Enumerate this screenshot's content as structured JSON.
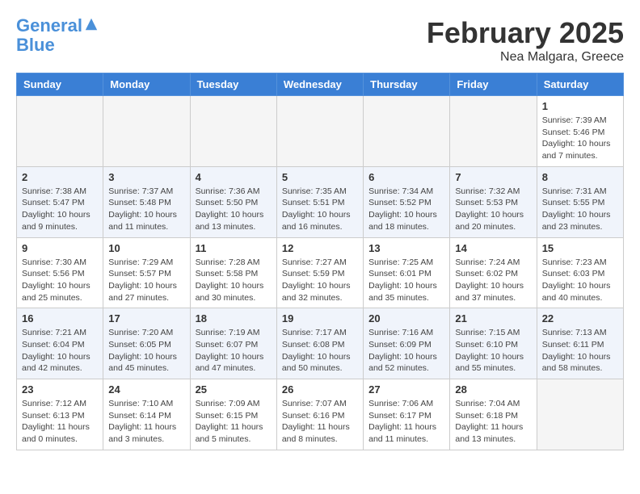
{
  "logo": {
    "line1": "General",
    "line2": "Blue"
  },
  "title": "February 2025",
  "location": "Nea Malgara, Greece",
  "weekdays": [
    "Sunday",
    "Monday",
    "Tuesday",
    "Wednesday",
    "Thursday",
    "Friday",
    "Saturday"
  ],
  "weeks": [
    [
      {
        "day": "",
        "info": ""
      },
      {
        "day": "",
        "info": ""
      },
      {
        "day": "",
        "info": ""
      },
      {
        "day": "",
        "info": ""
      },
      {
        "day": "",
        "info": ""
      },
      {
        "day": "",
        "info": ""
      },
      {
        "day": "1",
        "info": "Sunrise: 7:39 AM\nSunset: 5:46 PM\nDaylight: 10 hours and 7 minutes."
      }
    ],
    [
      {
        "day": "2",
        "info": "Sunrise: 7:38 AM\nSunset: 5:47 PM\nDaylight: 10 hours and 9 minutes."
      },
      {
        "day": "3",
        "info": "Sunrise: 7:37 AM\nSunset: 5:48 PM\nDaylight: 10 hours and 11 minutes."
      },
      {
        "day": "4",
        "info": "Sunrise: 7:36 AM\nSunset: 5:50 PM\nDaylight: 10 hours and 13 minutes."
      },
      {
        "day": "5",
        "info": "Sunrise: 7:35 AM\nSunset: 5:51 PM\nDaylight: 10 hours and 16 minutes."
      },
      {
        "day": "6",
        "info": "Sunrise: 7:34 AM\nSunset: 5:52 PM\nDaylight: 10 hours and 18 minutes."
      },
      {
        "day": "7",
        "info": "Sunrise: 7:32 AM\nSunset: 5:53 PM\nDaylight: 10 hours and 20 minutes."
      },
      {
        "day": "8",
        "info": "Sunrise: 7:31 AM\nSunset: 5:55 PM\nDaylight: 10 hours and 23 minutes."
      }
    ],
    [
      {
        "day": "9",
        "info": "Sunrise: 7:30 AM\nSunset: 5:56 PM\nDaylight: 10 hours and 25 minutes."
      },
      {
        "day": "10",
        "info": "Sunrise: 7:29 AM\nSunset: 5:57 PM\nDaylight: 10 hours and 27 minutes."
      },
      {
        "day": "11",
        "info": "Sunrise: 7:28 AM\nSunset: 5:58 PM\nDaylight: 10 hours and 30 minutes."
      },
      {
        "day": "12",
        "info": "Sunrise: 7:27 AM\nSunset: 5:59 PM\nDaylight: 10 hours and 32 minutes."
      },
      {
        "day": "13",
        "info": "Sunrise: 7:25 AM\nSunset: 6:01 PM\nDaylight: 10 hours and 35 minutes."
      },
      {
        "day": "14",
        "info": "Sunrise: 7:24 AM\nSunset: 6:02 PM\nDaylight: 10 hours and 37 minutes."
      },
      {
        "day": "15",
        "info": "Sunrise: 7:23 AM\nSunset: 6:03 PM\nDaylight: 10 hours and 40 minutes."
      }
    ],
    [
      {
        "day": "16",
        "info": "Sunrise: 7:21 AM\nSunset: 6:04 PM\nDaylight: 10 hours and 42 minutes."
      },
      {
        "day": "17",
        "info": "Sunrise: 7:20 AM\nSunset: 6:05 PM\nDaylight: 10 hours and 45 minutes."
      },
      {
        "day": "18",
        "info": "Sunrise: 7:19 AM\nSunset: 6:07 PM\nDaylight: 10 hours and 47 minutes."
      },
      {
        "day": "19",
        "info": "Sunrise: 7:17 AM\nSunset: 6:08 PM\nDaylight: 10 hours and 50 minutes."
      },
      {
        "day": "20",
        "info": "Sunrise: 7:16 AM\nSunset: 6:09 PM\nDaylight: 10 hours and 52 minutes."
      },
      {
        "day": "21",
        "info": "Sunrise: 7:15 AM\nSunset: 6:10 PM\nDaylight: 10 hours and 55 minutes."
      },
      {
        "day": "22",
        "info": "Sunrise: 7:13 AM\nSunset: 6:11 PM\nDaylight: 10 hours and 58 minutes."
      }
    ],
    [
      {
        "day": "23",
        "info": "Sunrise: 7:12 AM\nSunset: 6:13 PM\nDaylight: 11 hours and 0 minutes."
      },
      {
        "day": "24",
        "info": "Sunrise: 7:10 AM\nSunset: 6:14 PM\nDaylight: 11 hours and 3 minutes."
      },
      {
        "day": "25",
        "info": "Sunrise: 7:09 AM\nSunset: 6:15 PM\nDaylight: 11 hours and 5 minutes."
      },
      {
        "day": "26",
        "info": "Sunrise: 7:07 AM\nSunset: 6:16 PM\nDaylight: 11 hours and 8 minutes."
      },
      {
        "day": "27",
        "info": "Sunrise: 7:06 AM\nSunset: 6:17 PM\nDaylight: 11 hours and 11 minutes."
      },
      {
        "day": "28",
        "info": "Sunrise: 7:04 AM\nSunset: 6:18 PM\nDaylight: 11 hours and 13 minutes."
      },
      {
        "day": "",
        "info": ""
      }
    ]
  ]
}
